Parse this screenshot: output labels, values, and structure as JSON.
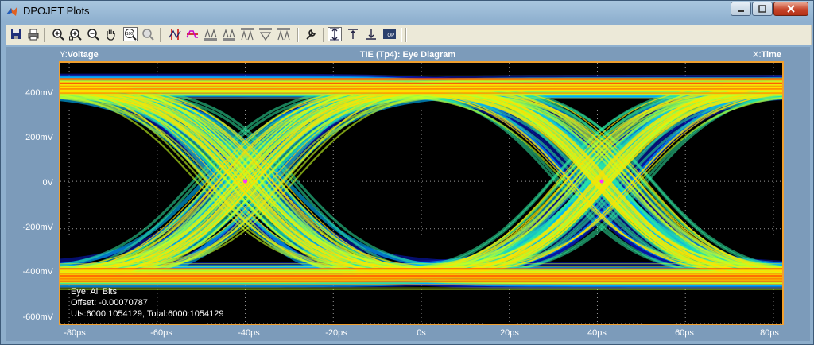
{
  "window": {
    "title": "DPOJET Plots",
    "buttons": [
      "minimize",
      "maximize",
      "close"
    ]
  },
  "toolbar": {
    "icons": [
      "save-icon",
      "print-icon",
      "zoom-in-icon",
      "zoom-in-box-icon",
      "zoom-out-icon",
      "pan-hand-icon",
      "zoom-100-icon",
      "zoom-area-icon",
      "cursor-vertical-icon",
      "cursor-waveform-icon",
      "reset-1-icon",
      "reset-2-icon",
      "zoom-1-icon",
      "zoom-2-icon",
      "zoom-3-icon",
      "settings-wrench-icon",
      "fit-vertical-icon",
      "align-top-icon",
      "align-bottom-icon",
      "top-icon"
    ]
  },
  "plot": {
    "title": "TIE (Tp4): Eye Diagram",
    "y_axis_prefix": "Y:",
    "y_axis_name": "Voltage",
    "x_axis_prefix": "X:",
    "x_axis_name": "Time",
    "y_ticks": [
      "400mV",
      "200mV",
      "0V",
      "-200mV",
      "-400mV",
      "-600mV"
    ],
    "x_ticks": [
      "-80ps",
      "-60ps",
      "-40ps",
      "-20ps",
      "0s",
      "20ps",
      "40ps",
      "60ps",
      "80ps"
    ],
    "info_lines": [
      "Eye: All Bits",
      "Offset: -0.00070787",
      "UIs:6000:1054129, Total:6000:1054129"
    ]
  },
  "chart_data": {
    "type": "heatmap",
    "title": "TIE (Tp4): Eye Diagram",
    "xlabel": "Time",
    "ylabel": "Voltage",
    "xlim": [
      -82,
      82
    ],
    "ylim": [
      -0.6,
      0.5
    ],
    "x_tick_labels": [
      "-80ps",
      "-60ps",
      "-40ps",
      "-20ps",
      "0s",
      "20ps",
      "40ps",
      "60ps",
      "80ps"
    ],
    "y_tick_labels": [
      "400mV",
      "200mV",
      "0V",
      "-200mV",
      "-400mV",
      "-600mV"
    ],
    "grid": true,
    "levels": {
      "high": 0.4,
      "low": -0.4
    },
    "crossings_ps": [
      -40,
      41
    ],
    "unit_interval_ps": 81,
    "color_scale": [
      "#0a1ccc",
      "#00b8ff",
      "#2ee8a0",
      "#c8ff20",
      "#ffe000",
      "#ff7a00",
      "#ff2400"
    ]
  }
}
